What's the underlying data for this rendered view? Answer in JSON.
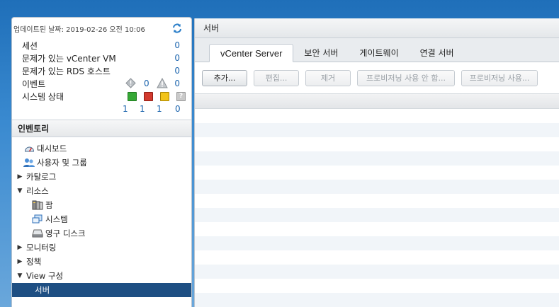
{
  "summary": {
    "updated": "업데이트된 날짜: 2019-02-26 오전 10:06",
    "rows": [
      {
        "label": "세션",
        "value": "0"
      },
      {
        "label": "문제가 있는 vCenter VM",
        "value": "0"
      },
      {
        "label": "문제가 있는 RDS 호스트",
        "value": "0"
      }
    ],
    "events": {
      "label": "이벤트",
      "warn_count": "0",
      "alert_count": "0"
    },
    "system_status": {
      "label": "시스템 상태",
      "counts": [
        "1",
        "1",
        "1",
        "0"
      ]
    },
    "status_colors": [
      "#36a836",
      "#d23a2e",
      "#f2c41b",
      "#c9c9c9"
    ]
  },
  "inventory": {
    "title": "인벤토리",
    "items": [
      {
        "label": "대시보드"
      },
      {
        "label": "사용자 및 그룹"
      },
      {
        "label": "카탈로그"
      },
      {
        "label": "리소스"
      },
      {
        "label": "팜"
      },
      {
        "label": "시스템"
      },
      {
        "label": "영구 디스크"
      },
      {
        "label": "모니터링"
      },
      {
        "label": "정책"
      },
      {
        "label": "View 구성"
      },
      {
        "label": "서버"
      }
    ]
  },
  "main": {
    "title": "서버",
    "tabs": [
      "vCenter Server",
      "보안 서버",
      "게이트웨이",
      "연결 서버"
    ],
    "buttons": [
      "추가...",
      "편집...",
      "제거",
      "프로비저닝 사용 안 함...",
      "프로비저닝 사용..."
    ]
  }
}
